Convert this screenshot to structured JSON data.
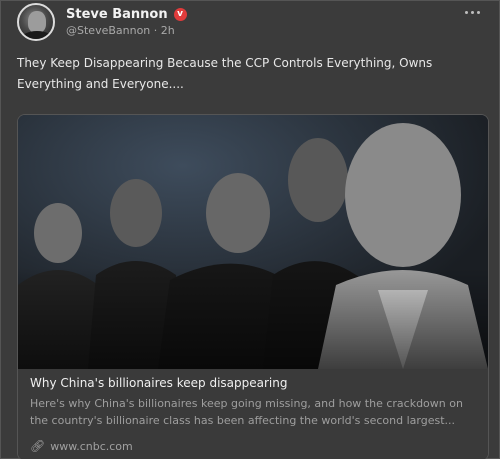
{
  "author": {
    "name": "Steve Bannon",
    "handle": "@SteveBannon",
    "separator": "·",
    "time": "2h",
    "verified_badge": "v"
  },
  "post": {
    "text": "They Keep Disappearing Because the CCP Controls Everything, Owns Everything and Everyone...."
  },
  "link_card": {
    "title": "Why China's billionaires keep disappearing",
    "description": "Here's why China's billionaires keep going missing, and how the crackdown on the country's billionaire class has been affecting the world's second largest...",
    "domain": "www.cnbc.com",
    "link_icon": "link-icon"
  },
  "icons": {
    "more": "more-dots-icon",
    "verified": "verified-badge-icon"
  },
  "colors": {
    "background": "#3b3b3b",
    "verified": "#e03b3b",
    "muted_text": "#a9a9a9"
  }
}
